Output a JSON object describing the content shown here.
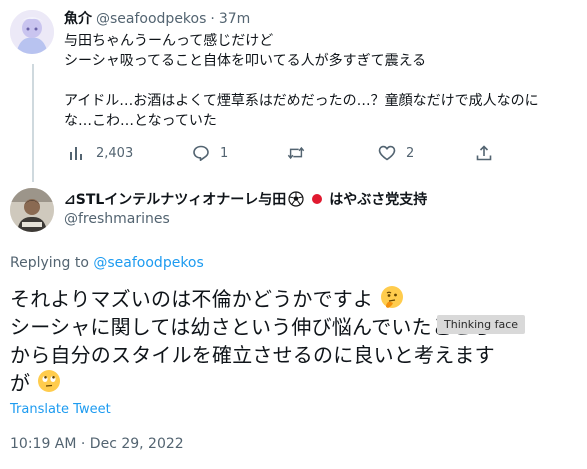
{
  "parent": {
    "display_name": "魚介",
    "handle": "@seafoodpekos",
    "separator": "·",
    "time": "37m",
    "text_lines": [
      "与田ちゃんうーんって感じだけど",
      "シーシャ吸ってること自体を叩いてる人が多すぎて震える",
      "",
      "アイドル…お酒はよくて煙草系はだめだったの…？童顔なだけで成人なのに",
      "な…こわ…となっていた"
    ],
    "views": "2,403",
    "replies": "1",
    "likes": "2"
  },
  "reply": {
    "display_name": "⊿STLインテルナツィオナーレ与田",
    "display_name_suffix": "はやぶさ党支持",
    "handle": "@freshmarines",
    "replying_prefix": "Replying to",
    "replying_to": "@seafoodpekos",
    "text_lines": [
      "それよりマズいのは不倫かどうかですよ",
      "シーシャに関しては幼さという伸び悩んでいたところ",
      "から自分のスタイルを確立させるのに良いと考えます",
      "が"
    ],
    "translate_label": "Translate Tweet",
    "timestamp": "10:19 AM · Dec 29, 2022",
    "tooltip": "Thinking face"
  },
  "colors": {
    "link": "#1d9bf0",
    "muted": "#536471",
    "line": "#cfd9de"
  }
}
